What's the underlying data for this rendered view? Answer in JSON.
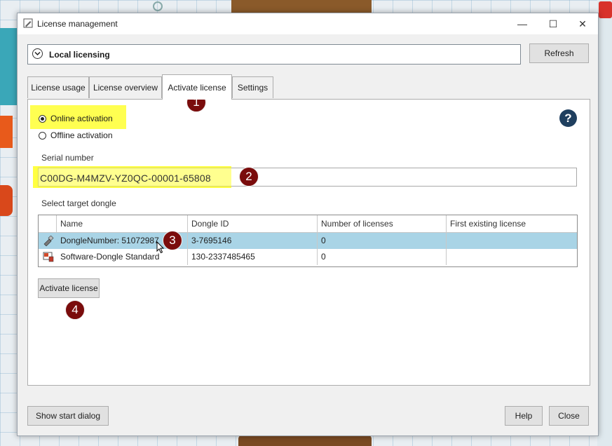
{
  "window": {
    "title": "License management",
    "controls": {
      "minimize": "—",
      "maximize": "☐",
      "close": "✕"
    }
  },
  "section": {
    "label": "Local licensing",
    "refresh_label": "Refresh"
  },
  "tabs": [
    {
      "label": "License usage",
      "active": false
    },
    {
      "label": "License overview",
      "active": false
    },
    {
      "label": "Activate license",
      "active": true
    },
    {
      "label": "Settings",
      "active": false
    }
  ],
  "activation": {
    "online_label": "Online activation",
    "offline_label": "Offline activation",
    "selected": "online",
    "help_symbol": "?"
  },
  "serial": {
    "label": "Serial number",
    "value": "C00DG-M4MZV-YZ0QC-00001-65808"
  },
  "dongle_table": {
    "label": "Select target dongle",
    "columns": [
      "Name",
      "Dongle ID",
      "Number of licenses",
      "First existing license"
    ],
    "rows": [
      {
        "icon": "usb-dongle-icon",
        "name": "DongleNumber: 51072987",
        "dongle_id": "3-7695146",
        "licenses": "0",
        "first": "",
        "selected": true
      },
      {
        "icon": "software-dongle-icon",
        "name": "Software-Dongle Standard",
        "dongle_id": "130-2337485465",
        "licenses": "0",
        "first": "",
        "selected": false
      }
    ]
  },
  "buttons": {
    "activate": "Activate license",
    "show_start": "Show start dialog",
    "help": "Help",
    "close": "Close"
  },
  "step_badges": [
    "1",
    "2",
    "3",
    "4"
  ],
  "colors": {
    "highlight": "#ffff33",
    "badge": "#7a0c0c",
    "selected_row": "#a9d4e6",
    "help_icon": "#1f3f5f"
  }
}
